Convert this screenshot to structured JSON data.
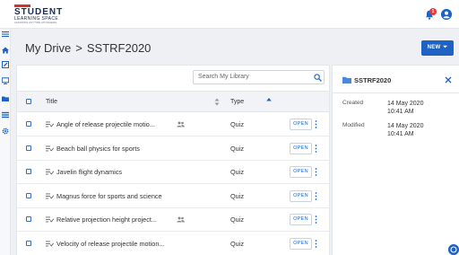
{
  "header": {
    "logo": {
      "line1": "STUDENT",
      "line2": "LEARNING SPACE",
      "line3": "LEARNING ANYTIME ANYWHERE"
    },
    "notification_count": "1",
    "colors": {
      "brand": "#1e63c4",
      "badge": "#e53935",
      "logo_text": "#1a2b4c"
    }
  },
  "rail": {
    "icons": [
      "menu-icon",
      "home-icon",
      "edit-icon",
      "presentation-icon",
      "folder-icon",
      "list-icon",
      "settings-icon"
    ]
  },
  "breadcrumb": {
    "root": "My Drive",
    "separator": ">",
    "current": "SSTRF2020"
  },
  "new_button": {
    "label": "NEW",
    "icon": "caret-down-icon"
  },
  "search": {
    "placeholder": "Search My Library",
    "icon": "search-icon"
  },
  "table": {
    "columns": {
      "title": "Title",
      "type": "Type"
    },
    "rows": [
      {
        "title": "Angle of release projectile motio...",
        "shared": true,
        "type": "Quiz",
        "action": "OPEN"
      },
      {
        "title": "Beach ball physics for sports",
        "shared": false,
        "type": "Quiz",
        "action": "OPEN"
      },
      {
        "title": "Javelin flight dynamics",
        "shared": false,
        "type": "Quiz",
        "action": "OPEN"
      },
      {
        "title": "Magnus force for sports and science",
        "shared": false,
        "type": "Quiz",
        "action": "OPEN"
      },
      {
        "title": "Relative projection height project...",
        "shared": true,
        "type": "Quiz",
        "action": "OPEN"
      },
      {
        "title": "Velocity of release projectile motion...",
        "shared": false,
        "type": "Quiz",
        "action": "OPEN"
      }
    ]
  },
  "details": {
    "name": "SSTRF2020",
    "created_label": "Created",
    "created_date": "14 May 2020",
    "created_time": "10:41 AM",
    "modified_label": "Modified",
    "modified_date": "14 May 2020",
    "modified_time": "10:41 AM"
  }
}
